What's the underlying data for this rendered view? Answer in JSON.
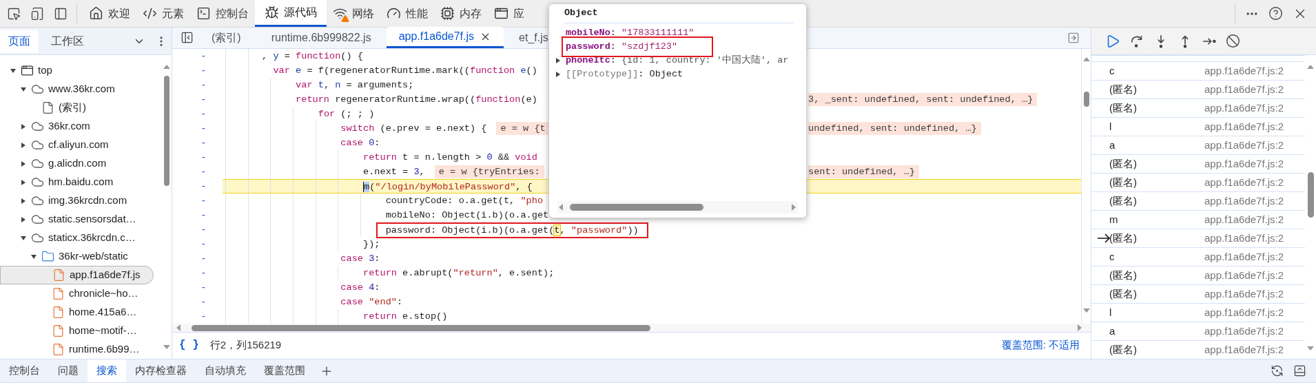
{
  "top_tabs": [
    {
      "label": "欢迎",
      "kind": "home",
      "selected": false,
      "warning": false
    },
    {
      "label": "元素",
      "kind": "code",
      "selected": false,
      "warning": false
    },
    {
      "label": "控制台",
      "kind": "terminal",
      "selected": false,
      "warning": false
    },
    {
      "label": "源代码",
      "kind": "bug",
      "selected": true,
      "warning": false
    },
    {
      "label": "网络",
      "kind": "wifi",
      "selected": false,
      "warning": true
    },
    {
      "label": "性能",
      "kind": "gauge",
      "selected": false,
      "warning": false
    },
    {
      "label": "内存",
      "kind": "cpu",
      "selected": false,
      "warning": false
    },
    {
      "label": "应",
      "kind": "app",
      "selected": false,
      "warning": false
    }
  ],
  "navigator": {
    "tabs": [
      {
        "label": "页面",
        "selected": true
      },
      {
        "label": "工作区",
        "selected": false
      }
    ],
    "tree": [
      {
        "label": "top",
        "kind": "frame",
        "expanded": true,
        "selected": false,
        "children": [
          {
            "label": "www.36kr.com",
            "kind": "domain",
            "expanded": true,
            "selected": false,
            "children": [
              {
                "label": "(索引)",
                "kind": "document",
                "selected": false
              }
            ]
          },
          {
            "label": "36kr.com",
            "kind": "domain",
            "expanded": false,
            "selected": false
          },
          {
            "label": "cf.aliyun.com",
            "kind": "domain",
            "expanded": false,
            "selected": false
          },
          {
            "label": "g.alicdn.com",
            "kind": "domain",
            "expanded": false,
            "selected": false
          },
          {
            "label": "hm.baidu.com",
            "kind": "domain",
            "expanded": false,
            "selected": false
          },
          {
            "label": "img.36krcdn.com",
            "kind": "domain",
            "expanded": false,
            "selected": false
          },
          {
            "label": "static.sensorsdat…",
            "kind": "domain",
            "expanded": false,
            "selected": false
          },
          {
            "label": "staticx.36krcdn.c…",
            "kind": "domain",
            "expanded": true,
            "selected": false,
            "children": [
              {
                "label": "36kr-web/static",
                "kind": "folder",
                "expanded": true,
                "selected": false,
                "children": [
                  {
                    "label": "app.f1a6de7f.js",
                    "kind": "script",
                    "selected": true
                  },
                  {
                    "label": "chronicle~ho…",
                    "kind": "script",
                    "selected": false
                  },
                  {
                    "label": "home.415a6…",
                    "kind": "script",
                    "selected": false
                  },
                  {
                    "label": "home~motif-…",
                    "kind": "script",
                    "selected": false
                  },
                  {
                    "label": "runtime.6b99…",
                    "kind": "script",
                    "selected": false
                  }
                ]
              }
            ]
          }
        ]
      }
    ]
  },
  "editor_tabs": [
    {
      "label": "(索引)",
      "selected": false,
      "closable": false
    },
    {
      "label": "runtime.6b999822.js",
      "selected": false,
      "closable": false
    },
    {
      "label": "app.f1a6de7f.js",
      "selected": true,
      "closable": true
    },
    {
      "label": "et_f.js",
      "selected": false,
      "closable": false
    }
  ],
  "code_lines": [
    {
      "gutter": "-",
      "paused": false,
      "highlighted": false,
      "tokens": [
        {
          "text": "       , ",
          "kind": "plain"
        },
        {
          "text": "y",
          "kind": "def"
        },
        {
          "text": " = ",
          "kind": "plain"
        },
        {
          "text": "function",
          "kind": "kw"
        },
        {
          "text": "() {",
          "kind": "plain"
        }
      ]
    },
    {
      "gutter": "-",
      "paused": false,
      "highlighted": false,
      "tokens": [
        {
          "text": "         var",
          "kind": "kw"
        },
        {
          "text": " e",
          "kind": "def"
        },
        {
          "text": " = f(regeneratorRuntime.mark((",
          "kind": "plain"
        },
        {
          "text": "function",
          "kind": "kw"
        },
        {
          "text": " e",
          "kind": "def"
        },
        {
          "text": "()",
          "kind": "plain"
        }
      ]
    },
    {
      "gutter": "-",
      "paused": false,
      "highlighted": false,
      "tokens": [
        {
          "text": "             var",
          "kind": "kw"
        },
        {
          "text": " t",
          "kind": "def"
        },
        {
          "text": ", ",
          "kind": "plain"
        },
        {
          "text": "n",
          "kind": "def"
        },
        {
          "text": " = arguments;",
          "kind": "plain"
        }
      ]
    },
    {
      "gutter": "-",
      "paused": false,
      "highlighted": false,
      "tokens": [
        {
          "text": "             return",
          "kind": "kw"
        },
        {
          "text": " regeneratorRuntime.wrap((",
          "kind": "plain"
        },
        {
          "text": "function",
          "kind": "kw"
        },
        {
          "text": "(e)",
          "kind": "plain"
        }
      ],
      "tail": "3, _sent: undefined, sent: undefined, …}"
    },
    {
      "gutter": "-",
      "paused": false,
      "highlighted": false,
      "tokens": [
        {
          "text": "                 for",
          "kind": "kw"
        },
        {
          "text": " (; ; )",
          "kind": "plain"
        }
      ]
    },
    {
      "gutter": "-",
      "paused": false,
      "highlighted": false,
      "tokens": [
        {
          "text": "                     switch",
          "kind": "kw"
        },
        {
          "text": " (e.prev = e.next) {",
          "kind": "plain"
        }
      ],
      "inline_value": "e = w {t",
      "tail": "undefined, sent: undefined, …}"
    },
    {
      "gutter": "-",
      "paused": false,
      "highlighted": false,
      "tokens": [
        {
          "text": "                     case",
          "kind": "kw"
        },
        {
          "text": " 0",
          "kind": "num"
        },
        {
          "text": ":",
          "kind": "plain"
        }
      ]
    },
    {
      "gutter": "-",
      "paused": false,
      "highlighted": false,
      "tokens": [
        {
          "text": "                         return",
          "kind": "kw"
        },
        {
          "text": " t = n.length > ",
          "kind": "plain"
        },
        {
          "text": "0",
          "kind": "num"
        },
        {
          "text": " && ",
          "kind": "plain"
        },
        {
          "text": "void",
          "kind": "kw"
        }
      ]
    },
    {
      "gutter": "-",
      "paused": false,
      "highlighted": false,
      "tokens": [
        {
          "text": "                         e.next = ",
          "kind": "plain"
        },
        {
          "text": "3",
          "kind": "num"
        },
        {
          "text": ",",
          "kind": "plain"
        }
      ],
      "inline_value": "e = w {tryEntries:",
      "tail": "sent: undefined, …}"
    },
    {
      "gutter": "-",
      "paused": true,
      "highlighted": false,
      "tokens": [
        {
          "text": "                         m",
          "kind": "cursor"
        },
        {
          "text": "(",
          "kind": "plain"
        },
        {
          "text": "\"/login/byMobilePassword\"",
          "kind": "str"
        },
        {
          "text": ", {",
          "kind": "plain"
        }
      ]
    },
    {
      "gutter": "-",
      "paused": false,
      "highlighted": false,
      "tokens": [
        {
          "text": "                             countryCode: o.a.get(t, ",
          "kind": "plain"
        },
        {
          "text": "\"pho",
          "kind": "str"
        }
      ]
    },
    {
      "gutter": "-",
      "paused": false,
      "highlighted": false,
      "tokens": [
        {
          "text": "                             mobileNo: Object(i.b)(o.a.get",
          "kind": "plain"
        }
      ]
    },
    {
      "gutter": "-",
      "paused": false,
      "highlighted": true,
      "tokens": [
        {
          "text": "                             password: Object(i.b)(o.a.get(",
          "kind": "plain"
        },
        {
          "text": "t",
          "kind": "mark"
        },
        {
          "text": ", ",
          "kind": "plain"
        },
        {
          "text": "\"password\"",
          "kind": "str"
        },
        {
          "text": "))",
          "kind": "plain"
        }
      ]
    },
    {
      "gutter": "-",
      "paused": false,
      "highlighted": false,
      "tokens": [
        {
          "text": "                         });",
          "kind": "plain"
        }
      ]
    },
    {
      "gutter": "-",
      "paused": false,
      "highlighted": false,
      "tokens": [
        {
          "text": "                     case",
          "kind": "kw"
        },
        {
          "text": " 3",
          "kind": "num"
        },
        {
          "text": ":",
          "kind": "plain"
        }
      ]
    },
    {
      "gutter": "-",
      "paused": false,
      "highlighted": false,
      "tokens": [
        {
          "text": "                         return",
          "kind": "kw"
        },
        {
          "text": " e.abrupt(",
          "kind": "plain"
        },
        {
          "text": "\"return\"",
          "kind": "str"
        },
        {
          "text": ", e.sent);",
          "kind": "plain"
        }
      ]
    },
    {
      "gutter": "-",
      "paused": false,
      "highlighted": false,
      "tokens": [
        {
          "text": "                     case",
          "kind": "kw"
        },
        {
          "text": " 4",
          "kind": "num"
        },
        {
          "text": ":",
          "kind": "plain"
        }
      ]
    },
    {
      "gutter": "-",
      "paused": false,
      "highlighted": false,
      "tokens": [
        {
          "text": "                     case",
          "kind": "kw"
        },
        {
          "text": " \"end\"",
          "kind": "str"
        },
        {
          "text": ":",
          "kind": "plain"
        }
      ]
    },
    {
      "gutter": "-",
      "paused": false,
      "highlighted": false,
      "tokens": [
        {
          "text": "                         return",
          "kind": "kw"
        },
        {
          "text": " e.stop()",
          "kind": "plain"
        }
      ]
    }
  ],
  "status_bar": {
    "format_button": "{ }",
    "position": "行2，列156219",
    "coverage": "覆盖范围: 不适用"
  },
  "popover": {
    "title": "Object",
    "properties": [
      {
        "key": "mobileNo",
        "separator": ": ",
        "value": "\"17833111111\"",
        "kind": "string",
        "expandable": false,
        "highlighted": false
      },
      {
        "key": "password",
        "separator": ": ",
        "value": "\"szdjf123\"",
        "kind": "string",
        "expandable": false,
        "highlighted": true
      },
      {
        "key": "phoneItc",
        "separator": ": ",
        "value": "{id: 1, country: '中国大陆', ar",
        "kind": "object",
        "expandable": true,
        "highlighted": false
      },
      {
        "key": "[[Prototype]]",
        "separator": ": ",
        "value": "Object",
        "kind": "internal",
        "expandable": true,
        "highlighted": false
      }
    ]
  },
  "call_stack": [
    {
      "name": "c",
      "location": "app.f1a6de7f.js:2",
      "current": false
    },
    {
      "name": "(匿名)",
      "location": "app.f1a6de7f.js:2",
      "current": false
    },
    {
      "name": "(匿名)",
      "location": "app.f1a6de7f.js:2",
      "current": false
    },
    {
      "name": "l",
      "location": "app.f1a6de7f.js:2",
      "current": false
    },
    {
      "name": "a",
      "location": "app.f1a6de7f.js:2",
      "current": false
    },
    {
      "name": "(匿名)",
      "location": "app.f1a6de7f.js:2",
      "current": false
    },
    {
      "name": "(匿名)",
      "location": "app.f1a6de7f.js:2",
      "current": false
    },
    {
      "name": "(匿名)",
      "location": "app.f1a6de7f.js:2",
      "current": false
    },
    {
      "name": "m",
      "location": "app.f1a6de7f.js:2",
      "current": false
    },
    {
      "name": "(匿名)",
      "location": "app.f1a6de7f.js:2",
      "current": true
    },
    {
      "name": "c",
      "location": "app.f1a6de7f.js:2",
      "current": false
    },
    {
      "name": "(匿名)",
      "location": "app.f1a6de7f.js:2",
      "current": false
    },
    {
      "name": "(匿名)",
      "location": "app.f1a6de7f.js:2",
      "current": false
    },
    {
      "name": "l",
      "location": "app.f1a6de7f.js:2",
      "current": false
    },
    {
      "name": "a",
      "location": "app.f1a6de7f.js:2",
      "current": false
    },
    {
      "name": "(匿名)",
      "location": "app.f1a6de7f.js:2",
      "current": false
    }
  ],
  "drawer_tabs": [
    {
      "label": "控制台",
      "selected": false
    },
    {
      "label": "问题",
      "selected": false
    },
    {
      "label": "搜索",
      "selected": true
    },
    {
      "label": "内存检查器",
      "selected": false
    },
    {
      "label": "自动填充",
      "selected": false
    },
    {
      "label": "覆盖范围",
      "selected": false
    }
  ]
}
